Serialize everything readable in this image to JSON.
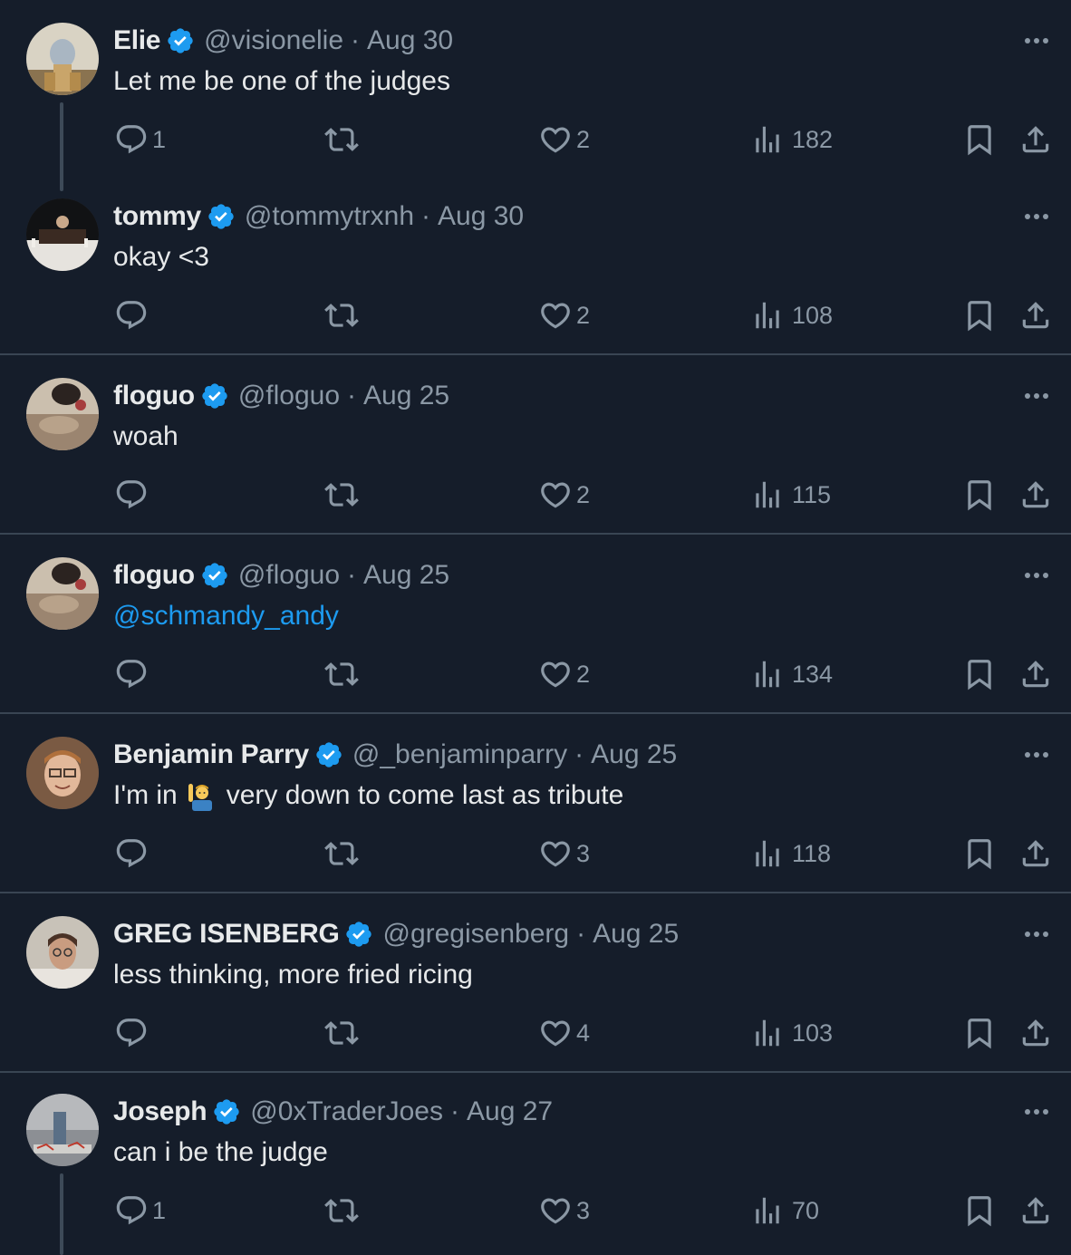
{
  "colors": {
    "background": "#151d2a",
    "text": "#e7e9ea",
    "muted": "#8b98a5",
    "verified": "#1d9bf0",
    "mention": "#1d9bf0",
    "divider": "#394553"
  },
  "icons": {
    "reply": "speech-bubble-icon",
    "repost": "repost-arrows-icon",
    "like": "heart-icon",
    "views": "bar-chart-icon",
    "bookmark": "bookmark-icon",
    "share": "share-upload-icon",
    "more": "ellipsis-icon",
    "verified": "verified-badge-icon"
  },
  "tweets": [
    {
      "name": "Elie",
      "handle": "@visionelie",
      "separator": "·",
      "date": "Aug 30",
      "text": "Let me be one of the judges",
      "replies": "1",
      "reposts": "",
      "likes": "2",
      "views": "182"
    },
    {
      "name": "tommy",
      "handle": "@tommytrxnh",
      "separator": "·",
      "date": "Aug 30",
      "text": "okay <3",
      "replies": "",
      "reposts": "",
      "likes": "2",
      "views": "108"
    },
    {
      "name": "floguo",
      "handle": "@floguo",
      "separator": "·",
      "date": "Aug 25",
      "text": "woah",
      "replies": "",
      "reposts": "",
      "likes": "2",
      "views": "115"
    },
    {
      "name": "floguo",
      "handle": "@floguo",
      "separator": "·",
      "date": "Aug 25",
      "mention": "@schmandy_andy",
      "replies": "",
      "reposts": "",
      "likes": "2",
      "views": "134"
    },
    {
      "name": "Benjamin Parry",
      "handle": "@_benjaminparry",
      "separator": "·",
      "date": "Aug 25",
      "text_before_emoji": "I'm in",
      "emoji": "person-raising-hand-emoji",
      "text_after_emoji": "very down to come last as tribute",
      "replies": "",
      "reposts": "",
      "likes": "3",
      "views": "118"
    },
    {
      "name": "GREG ISENBERG",
      "handle": "@gregisenberg",
      "separator": "·",
      "date": "Aug 25",
      "text": "less thinking, more fried ricing",
      "replies": "",
      "reposts": "",
      "likes": "4",
      "views": "103"
    },
    {
      "name": "Joseph",
      "handle": "@0xTraderJoes",
      "separator": "·",
      "date": "Aug 27",
      "text": "can i be the judge",
      "replies": "1",
      "reposts": "",
      "likes": "3",
      "views": "70"
    }
  ]
}
